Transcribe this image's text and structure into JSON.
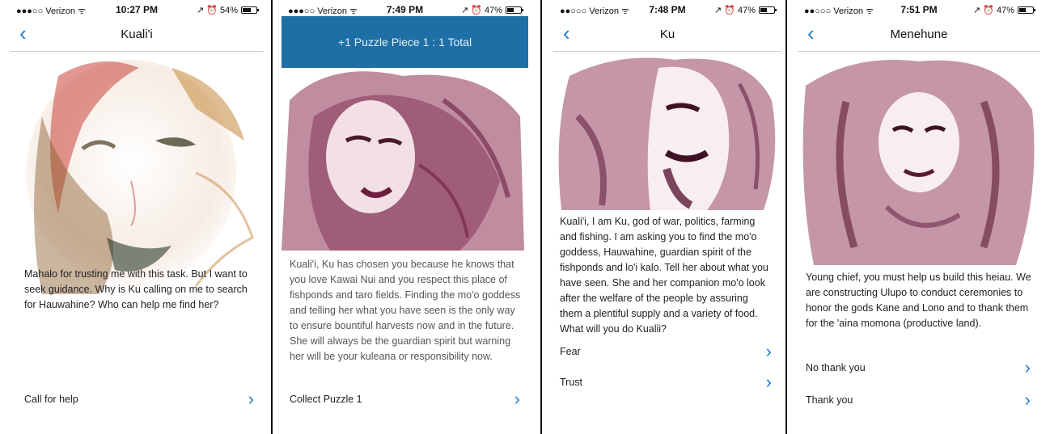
{
  "screens": [
    {
      "status": {
        "carrier": "●●●○○ Verizon ᯤ",
        "time": "10:27 PM",
        "right": "↗ ⏰ 54%",
        "battery": 54
      },
      "nav": {
        "title": "Kuali'i"
      },
      "portrait_icon": "sketch-portrait-woman",
      "text": "Mahalo for trusting me with this task. But I want to seek guidance. Why is Ku calling on me to search for Hauwahine? Who can help me find her?",
      "options": [
        {
          "label": "Call for help"
        }
      ]
    },
    {
      "status": {
        "carrier": "●●●○○ Verizon ᯤ",
        "time": "7:49 PM",
        "right": "↗ ⏰ 47%",
        "battery": 47
      },
      "banner": "+1 Puzzle Piece 1 : 1 Total",
      "portrait_icon": "sketch-portrait-ku",
      "text": "Kuali'i, Ku has chosen you because he knows that you love Kawai Nui and you respect this place of fishponds and taro fields. Finding the mo'o goddess and telling her what you have seen is the only way to ensure bountiful harvests now and in the future. She will always be the guardian spirit but warning her will be your kuleana or responsibility now.",
      "options": [
        {
          "label": "Collect Puzzle 1"
        }
      ]
    },
    {
      "status": {
        "carrier": "●●○○○ Verizon ᯤ",
        "time": "7:48 PM",
        "right": "↗ ⏰ 47%",
        "battery": 47
      },
      "nav": {
        "title": "Ku"
      },
      "portrait_icon": "sketch-portrait-man",
      "text": "Kuali'i, I am Ku, god of war, politics, farming and fishing. I am asking you to find the mo'o goddess, Hauwahine, guardian spirit of the fishponds and lo'i kalo. Tell her about what you have seen. She and her companion mo'o look after the welfare of the people by assuring them a plentiful supply and a variety of food. What will you do Kualii?",
      "options": [
        {
          "label": "Fear"
        },
        {
          "label": "Trust"
        }
      ]
    },
    {
      "status": {
        "carrier": "●●○○○ Verizon ᯤ",
        "time": "7:51 PM",
        "right": "↗ ⏰ 47%",
        "battery": 47
      },
      "nav": {
        "title": "Menehune"
      },
      "portrait_icon": "sketch-portrait-menehune",
      "text": "Young chief, you must help us build this heiau. We are constructing Ulupo to conduct ceremonies to honor the gods Kane and Lono and to thank them for the 'aina momona (productive land).",
      "options": [
        {
          "label": "No thank you"
        },
        {
          "label": "Thank you"
        }
      ]
    }
  ],
  "chevron": "›",
  "back": "‹"
}
